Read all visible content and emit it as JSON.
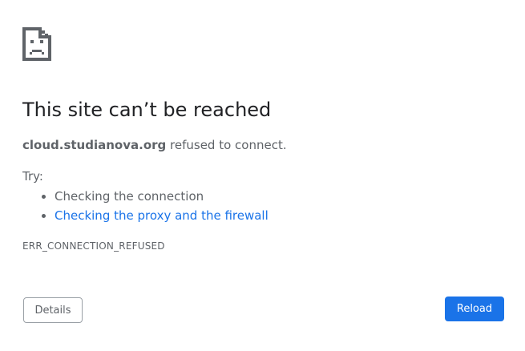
{
  "icon": "sad-document-icon",
  "title": "This site can’t be reached",
  "summary": {
    "host": "cloud.studianova.org",
    "message": " refused to connect."
  },
  "try_label": "Try:",
  "suggestions": [
    {
      "text": "Checking the connection",
      "link": false
    },
    {
      "text": "Checking the proxy and the firewall",
      "link": true
    }
  ],
  "error_code": "ERR_CONNECTION_REFUSED",
  "buttons": {
    "details": "Details",
    "reload": "Reload"
  },
  "colors": {
    "link": "#1a73e8",
    "primary_button": "#1a73e8",
    "text": "#5f6368",
    "title": "#202124"
  }
}
